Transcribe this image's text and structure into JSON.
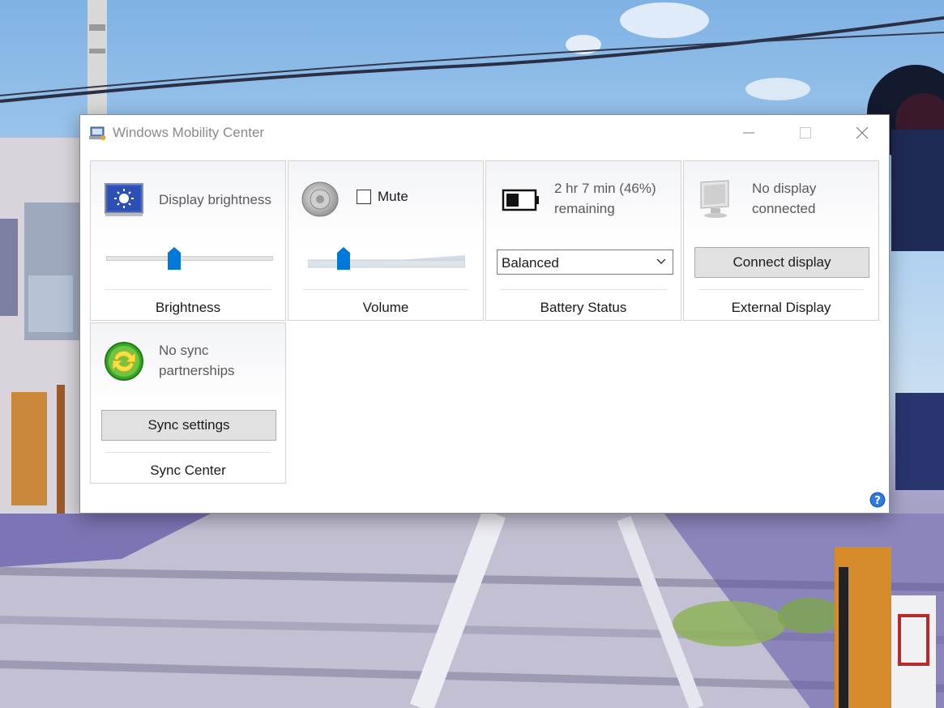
{
  "window": {
    "title": "Windows Mobility Center",
    "controls": {
      "minimize": "minimize-icon",
      "maximize": "maximize-icon",
      "close": "close-icon"
    }
  },
  "tiles": {
    "brightness": {
      "text": "Display brightness",
      "label": "Brightness",
      "icon": "display-brightness-icon",
      "level": 0.4
    },
    "volume": {
      "mute_label": "Mute",
      "mute_checked": false,
      "label": "Volume",
      "icon": "speaker-icon",
      "level": 0.2
    },
    "battery": {
      "line1": "2 hr 7 min (46%)",
      "line2": "remaining",
      "plan_value": "Balanced",
      "label": "Battery Status",
      "icon": "battery-icon",
      "level": 0.46
    },
    "display": {
      "line1": "No display",
      "line2": "connected",
      "button": "Connect display",
      "label": "External Display",
      "icon": "monitor-icon"
    },
    "sync": {
      "line1": "No sync",
      "line2": "partnerships",
      "button": "Sync settings",
      "label": "Sync Center",
      "icon": "sync-icon"
    }
  },
  "help": {
    "icon": "help-icon"
  },
  "colors": {
    "accent": "#0078d7",
    "sync_green": "#3aa827",
    "title_gray": "#8a8a8a"
  }
}
